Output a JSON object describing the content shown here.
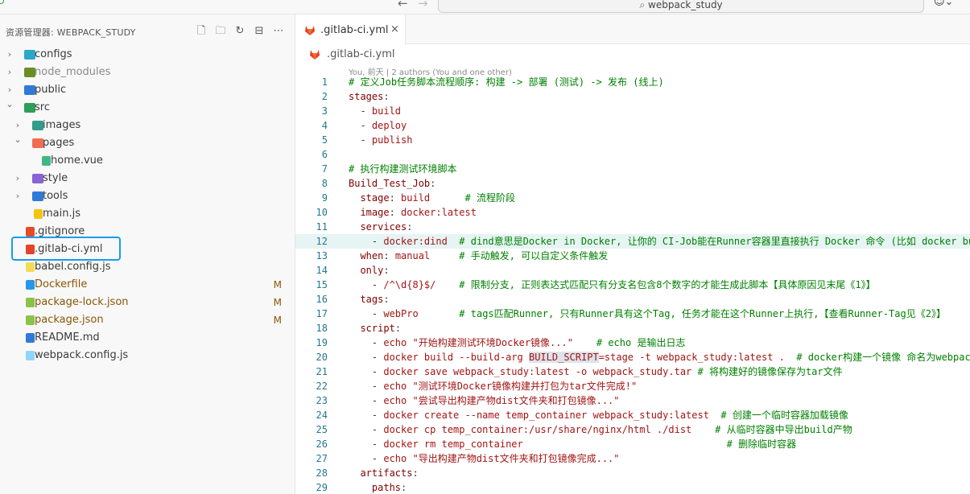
{
  "titlebar": {
    "back_glyph": "←",
    "forward_glyph": "→",
    "search_text": "webpack_study",
    "search_icon": "search-icon",
    "copilot_icon": "copilot-icon"
  },
  "explorer": {
    "header": "资源管理器: WEBPACK_STUDY",
    "actions": [
      "new-file-icon",
      "new-folder-icon",
      "refresh-icon",
      "collapse-all-icon",
      "more-icon"
    ],
    "tree": [
      {
        "label": "configs",
        "type": "folder",
        "expanded": false,
        "depth": 0,
        "icon_color": "#2aa7c9"
      },
      {
        "label": "node_modules",
        "type": "folder",
        "expanded": false,
        "depth": 0,
        "icon_color": "#6b8e23",
        "dim": true
      },
      {
        "label": "public",
        "type": "folder",
        "expanded": false,
        "depth": 0,
        "icon_color": "#2f7ad8"
      },
      {
        "label": "src",
        "type": "folder",
        "expanded": true,
        "depth": 0,
        "icon_color": "#2e9e59"
      },
      {
        "label": "images",
        "type": "folder",
        "expanded": false,
        "depth": 1,
        "icon_color": "#2e9e88"
      },
      {
        "label": "pages",
        "type": "folder",
        "expanded": true,
        "depth": 1,
        "icon_color": "#f26d4f"
      },
      {
        "label": "home.vue",
        "type": "file",
        "depth": 2,
        "icon_color": "#41b883"
      },
      {
        "label": "style",
        "type": "folder",
        "expanded": false,
        "depth": 1,
        "icon_color": "#8a63d2"
      },
      {
        "label": "tools",
        "type": "folder",
        "expanded": false,
        "depth": 1,
        "icon_color": "#2f7ad8"
      },
      {
        "label": "main.js",
        "type": "file",
        "depth": 1,
        "icon_color": "#f1c40f"
      },
      {
        "label": ".gitignore",
        "type": "file",
        "depth": 0,
        "icon_color": "#e44d26"
      },
      {
        "label": ".gitlab-ci.yml",
        "type": "file",
        "depth": 0,
        "icon_color": "#e2432a",
        "selected": true
      },
      {
        "label": "babel.config.js",
        "type": "file",
        "depth": 0,
        "icon_color": "#f5da55"
      },
      {
        "label": "Dockerfile",
        "type": "file",
        "depth": 0,
        "icon_color": "#2496ed",
        "modified": true,
        "badge": "M"
      },
      {
        "label": "package-lock.json",
        "type": "file",
        "depth": 0,
        "icon_color": "#8bc34a",
        "modified": true,
        "badge": "M"
      },
      {
        "label": "package.json",
        "type": "file",
        "depth": 0,
        "icon_color": "#8bc34a",
        "modified": true,
        "badge": "M"
      },
      {
        "label": "README.md",
        "type": "file",
        "depth": 0,
        "icon_color": "#2f7ad8"
      },
      {
        "label": "webpack.config.js",
        "type": "file",
        "depth": 0,
        "icon_color": "#8ed6fb"
      }
    ]
  },
  "editor": {
    "tab": {
      "label": ".gitlab-ci.yml",
      "close_glyph": "×"
    },
    "breadcrumb": ".gitlab-ci.yml",
    "blame": "You, 前天 | 2 authors (You and one other)",
    "lines": [
      [
        [
          "c",
          "# 定义Job任务脚本流程顺序: 构建 -> 部署 (测试) -> 发布 (线上)"
        ]
      ],
      [
        [
          "k",
          "stages"
        ],
        [
          "n",
          ":"
        ]
      ],
      [
        [
          "n",
          "  - "
        ],
        [
          "s",
          "build"
        ]
      ],
      [
        [
          "n",
          "  - "
        ],
        [
          "s",
          "deploy"
        ]
      ],
      [
        [
          "n",
          "  - "
        ],
        [
          "s",
          "publish"
        ]
      ],
      [],
      [
        [
          "c",
          "# 执行构建测试环境脚本"
        ]
      ],
      [
        [
          "k",
          "Build_Test_Job"
        ],
        [
          "n",
          ":"
        ]
      ],
      [
        [
          "n",
          "  "
        ],
        [
          "k",
          "stage"
        ],
        [
          "n",
          ": "
        ],
        [
          "s",
          "build"
        ],
        [
          "n",
          "      "
        ],
        [
          "c",
          "# 流程阶段"
        ]
      ],
      [
        [
          "n",
          "  "
        ],
        [
          "k",
          "image"
        ],
        [
          "n",
          ": "
        ],
        [
          "s",
          "docker:latest"
        ]
      ],
      [
        [
          "n",
          "  "
        ],
        [
          "k",
          "services"
        ],
        [
          "n",
          ":"
        ]
      ],
      [
        [
          "n",
          "    - "
        ],
        [
          "s",
          "docker:dind"
        ],
        [
          "n",
          "  "
        ],
        [
          "c",
          "# dind意思是Docker in Docker, 让你的 CI-Job能在Runner容器里直接执行 Docker 命令 (比如 docker build)"
        ]
      ],
      [
        [
          "n",
          "  "
        ],
        [
          "k",
          "when"
        ],
        [
          "n",
          ": "
        ],
        [
          "s",
          "manual"
        ],
        [
          "n",
          "     "
        ],
        [
          "c",
          "# 手动触发, 可以自定义条件触发"
        ]
      ],
      [
        [
          "n",
          "  "
        ],
        [
          "k",
          "only"
        ],
        [
          "n",
          ":"
        ]
      ],
      [
        [
          "n",
          "    - "
        ],
        [
          "s",
          "/^\\d{8}$/"
        ],
        [
          "n",
          "    "
        ],
        [
          "c",
          "# 限制分支, 正则表达式匹配只有分支名包含8个数字的才能生成此脚本【具体原因见末尾《1》】"
        ]
      ],
      [
        [
          "n",
          "  "
        ],
        [
          "k",
          "tags"
        ],
        [
          "n",
          ":"
        ]
      ],
      [
        [
          "n",
          "    - "
        ],
        [
          "s",
          "webPro"
        ],
        [
          "n",
          "       "
        ],
        [
          "c",
          "# tags匹配Runner, 只有Runner具有这个Tag, 任务才能在这个Runner上执行,【查看Runner-Tag见《2》】"
        ]
      ],
      [
        [
          "n",
          "  "
        ],
        [
          "k",
          "script"
        ],
        [
          "n",
          ":"
        ]
      ],
      [
        [
          "n",
          "    - "
        ],
        [
          "s",
          "echo \"开始构建测试环境Docker镜像...\""
        ],
        [
          "n",
          "    "
        ],
        [
          "c",
          "# echo 是输出日志"
        ]
      ],
      [
        [
          "n",
          "    - "
        ],
        [
          "s",
          "docker build --build-arg "
        ],
        [
          "h",
          "BUILD_SCRIPT"
        ],
        [
          "s",
          "=stage -t webpack_study:latest ."
        ],
        [
          "n",
          "  "
        ],
        [
          "c",
          "# docker构建一个镜像 命名为webpack_study:latest"
        ]
      ],
      [
        [
          "n",
          "    - "
        ],
        [
          "s",
          "docker save webpack_study:latest -o webpack_study.tar"
        ],
        [
          "n",
          " "
        ],
        [
          "c",
          "# 将构建好的镜像保存为tar文件"
        ]
      ],
      [
        [
          "n",
          "    - "
        ],
        [
          "s",
          "echo \"测试环境Docker镜像构建并打包为tar文件完成!\""
        ]
      ],
      [
        [
          "n",
          "    - "
        ],
        [
          "s",
          "echo \"尝试导出构建产物dist文件夹和打包镜像...\""
        ]
      ],
      [
        [
          "n",
          "    - "
        ],
        [
          "s",
          "docker create --name temp_container webpack_study:latest"
        ],
        [
          "n",
          "  "
        ],
        [
          "c",
          "# 创建一个临时容器加载镜像"
        ]
      ],
      [
        [
          "n",
          "    - "
        ],
        [
          "s",
          "docker cp temp_container:/usr/share/nginx/html ./dist"
        ],
        [
          "n",
          "    "
        ],
        [
          "c",
          "# 从临时容器中导出build产物"
        ]
      ],
      [
        [
          "n",
          "    - "
        ],
        [
          "s",
          "docker rm temp_container"
        ],
        [
          "n",
          "                                   "
        ],
        [
          "c",
          "# 删除临时容器"
        ]
      ],
      [
        [
          "n",
          "    - "
        ],
        [
          "s",
          "echo \"导出构建产物dist文件夹和打包镜像完成...\""
        ]
      ],
      [
        [
          "n",
          "  "
        ],
        [
          "k",
          "artifacts"
        ],
        [
          "n",
          ":"
        ]
      ],
      [
        [
          "n",
          "    "
        ],
        [
          "k",
          "paths"
        ],
        [
          "n",
          ":"
        ]
      ]
    ],
    "highlighted_line": 12
  },
  "colors": {
    "selection_outline": "#1a9bf0",
    "modified_badge": "#895503",
    "gitlab_orange": "#e2432a",
    "line_number": "#237893"
  }
}
